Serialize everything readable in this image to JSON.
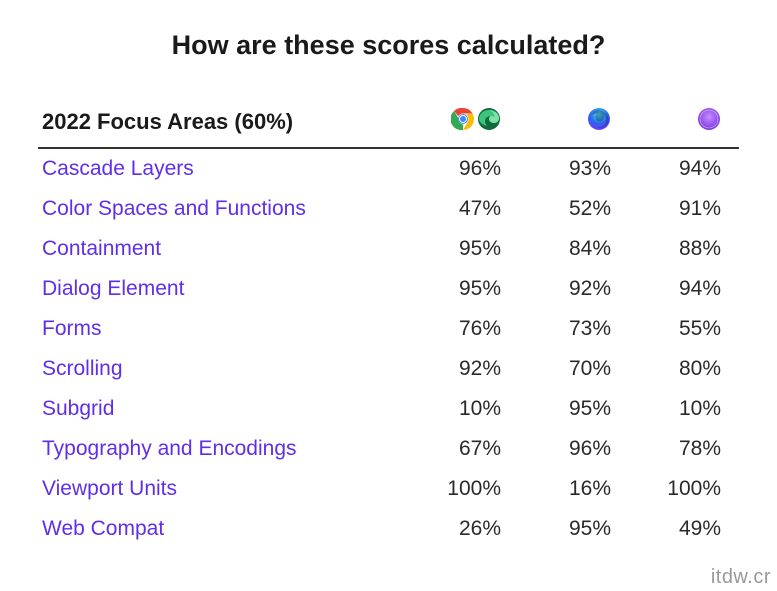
{
  "title": "How are these scores calculated?",
  "table": {
    "header": "2022 Focus Areas (60%)",
    "columns": [
      {
        "id": "chrome-edge",
        "icons": [
          "chrome-dev-icon",
          "edge-dev-icon"
        ]
      },
      {
        "id": "firefox",
        "icons": [
          "firefox-icon"
        ]
      },
      {
        "id": "safari",
        "icons": [
          "safari-icon"
        ]
      }
    ],
    "rows": [
      {
        "label": "Cascade Layers",
        "values": [
          "96%",
          "93%",
          "94%"
        ]
      },
      {
        "label": "Color Spaces and Functions",
        "values": [
          "47%",
          "52%",
          "91%"
        ]
      },
      {
        "label": "Containment",
        "values": [
          "95%",
          "84%",
          "88%"
        ]
      },
      {
        "label": "Dialog Element",
        "values": [
          "95%",
          "92%",
          "94%"
        ]
      },
      {
        "label": "Forms",
        "values": [
          "76%",
          "73%",
          "55%"
        ]
      },
      {
        "label": "Scrolling",
        "values": [
          "92%",
          "70%",
          "80%"
        ]
      },
      {
        "label": "Subgrid",
        "values": [
          "10%",
          "95%",
          "10%"
        ]
      },
      {
        "label": "Typography and Encodings",
        "values": [
          "67%",
          "96%",
          "78%"
        ]
      },
      {
        "label": "Viewport Units",
        "values": [
          "100%",
          "16%",
          "100%"
        ]
      },
      {
        "label": "Web Compat",
        "values": [
          "26%",
          "95%",
          "49%"
        ]
      }
    ]
  },
  "watermark": "itdw.cr",
  "chart_data": {
    "type": "table",
    "title": "2022 Focus Areas (60%)",
    "categories": [
      "Cascade Layers",
      "Color Spaces and Functions",
      "Containment",
      "Dialog Element",
      "Forms",
      "Scrolling",
      "Subgrid",
      "Typography and Encodings",
      "Viewport Units",
      "Web Compat"
    ],
    "series": [
      {
        "name": "Chrome/Edge",
        "values": [
          96,
          47,
          95,
          95,
          76,
          92,
          10,
          67,
          100,
          26
        ]
      },
      {
        "name": "Firefox",
        "values": [
          93,
          52,
          84,
          92,
          73,
          70,
          95,
          96,
          16,
          95
        ]
      },
      {
        "name": "Safari",
        "values": [
          94,
          91,
          88,
          94,
          55,
          80,
          10,
          78,
          100,
          49
        ]
      }
    ]
  }
}
